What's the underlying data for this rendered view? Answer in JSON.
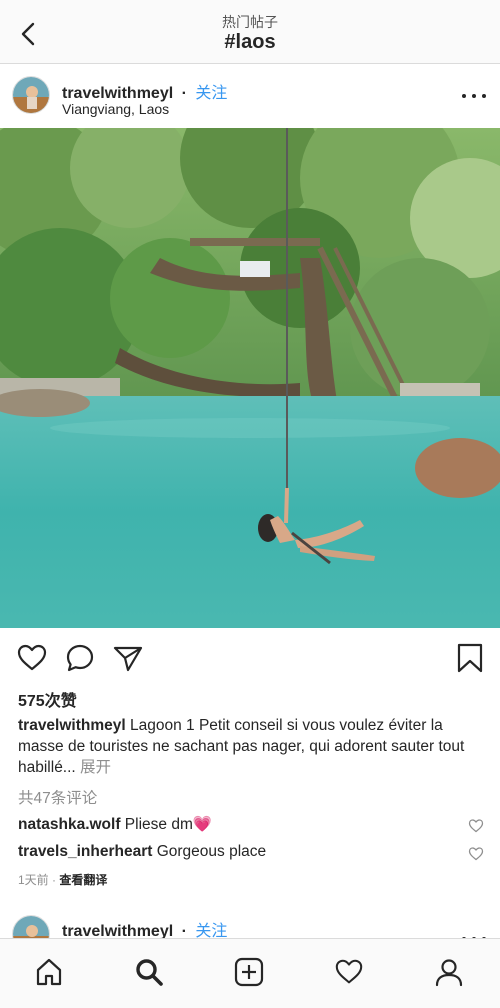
{
  "nav": {
    "subtitle": "热门帖子",
    "title": "#laos"
  },
  "post": {
    "username": "travelwithmeyl",
    "separator": "·",
    "follow_label": "关注",
    "location": "Viangviang, Laos",
    "likes": "575次赞",
    "caption_user": "travelwithmeyl",
    "caption_text": " Lagoon 1 Petit conseil si vous voulez éviter la masse de touristes ne sachant pas nager, qui adorent sauter tout habillé...",
    "caption_more": " 展开",
    "view_comments": "共47条评论",
    "comments": [
      {
        "user": "natashka.wolf",
        "text": " Pliese dm💗"
      },
      {
        "user": "travels_inherheart",
        "text": " Gorgeous place"
      }
    ],
    "time": "1天前",
    "meta_sep": " · ",
    "translate_label": "查看翻译"
  },
  "next_post": {
    "username": "travelwithmeyl",
    "separator": "·",
    "follow_label": "关注"
  },
  "colors": {
    "accent": "#3897f0",
    "text": "#262626",
    "muted": "#8e8e8e"
  },
  "icons": {
    "nav": "back-arrow",
    "post_actions": [
      "heart-outline",
      "comment-bubble",
      "share-paper-plane",
      "bookmark"
    ],
    "tabbar": [
      "home",
      "search",
      "add-post",
      "activity-heart",
      "profile"
    ]
  }
}
